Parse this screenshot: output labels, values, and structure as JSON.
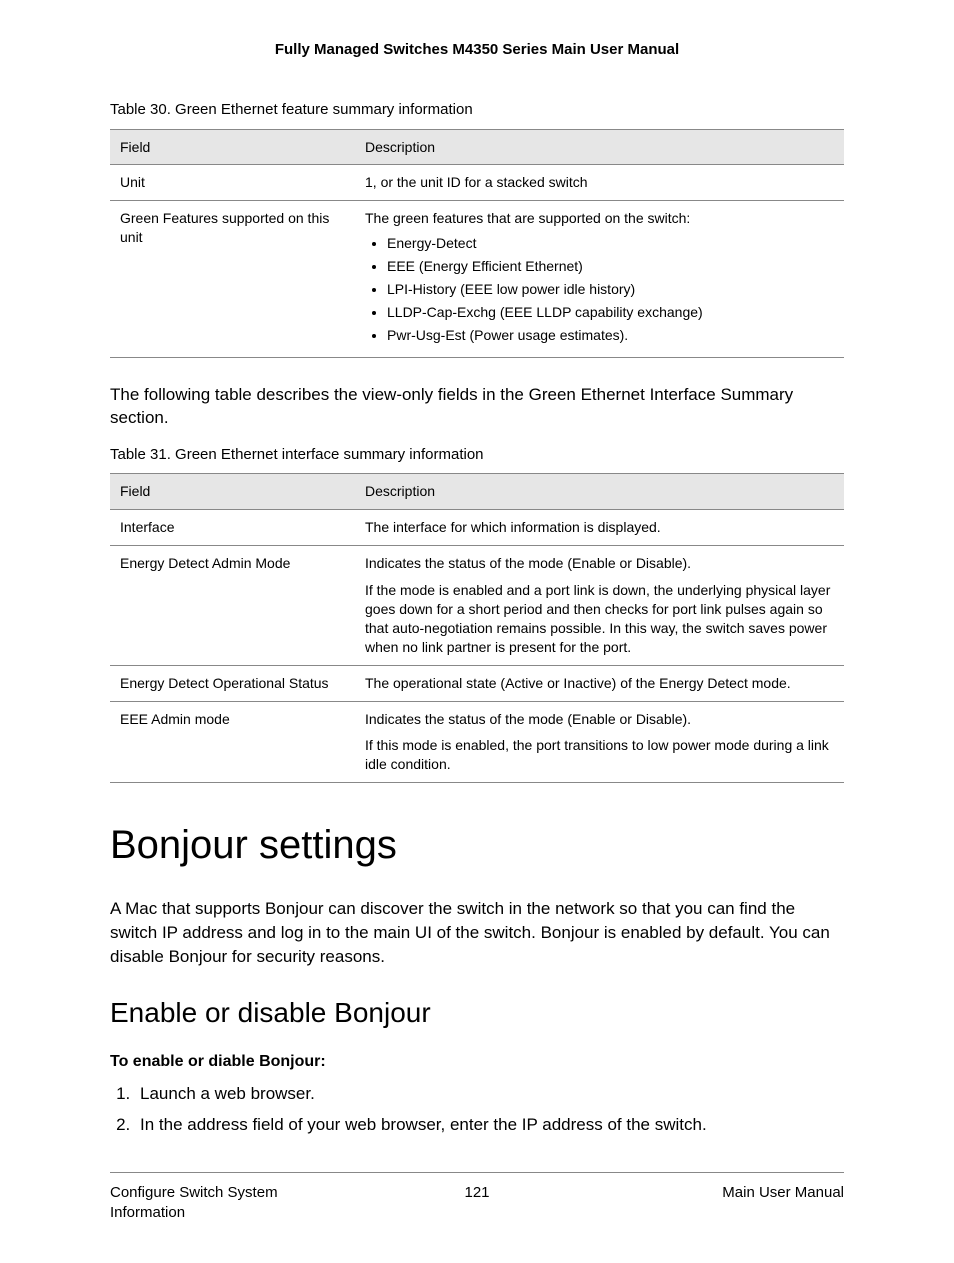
{
  "header": {
    "title": "Fully Managed Switches M4350 Series Main User Manual"
  },
  "table30": {
    "caption": "Table 30. Green Ethernet feature summary information",
    "head": {
      "field": "Field",
      "desc": "Description"
    },
    "rows": [
      {
        "field": "Unit",
        "desc": "1, or the unit ID for a stacked switch"
      },
      {
        "field": "Green Features supported on this unit",
        "desc_intro": "The green features that are supported on the switch:",
        "features": [
          "Energy-Detect",
          "EEE (Energy Efficient Ethernet)",
          "LPI-History (EEE low power idle history)",
          "LLDP-Cap-Exchg (EEE LLDP capability exchange)",
          "Pwr-Usg-Est (Power usage estimates)."
        ]
      }
    ]
  },
  "para1": "The following table describes the view-only fields in the Green Ethernet Interface Summary section.",
  "table31": {
    "caption": "Table 31. Green Ethernet interface summary information",
    "head": {
      "field": "Field",
      "desc": "Description"
    },
    "rows": [
      {
        "field": "Interface",
        "desc": "The interface for which information is displayed."
      },
      {
        "field": "Energy Detect Admin Mode",
        "desc1": "Indicates the status of the mode (Enable or Disable).",
        "desc2": "If the mode is enabled and a port link is down, the underlying physical layer goes down for a short period and then checks for port link pulses again so that auto-negotiation remains possible. In this way, the switch saves power when no link partner is present for the port."
      },
      {
        "field": "Energy Detect Operational Status",
        "desc": "The operational state (Active or Inactive) of the Energy Detect mode."
      },
      {
        "field": "EEE Admin mode",
        "desc1": "Indicates the status of the mode (Enable or Disable).",
        "desc2": "If this mode is enabled, the port transitions to low power mode during a link idle condition."
      }
    ]
  },
  "section": {
    "heading": "Bonjour settings",
    "intro": "A Mac that supports Bonjour can discover the switch in the network so that you can find the switch IP address and log in to the main UI of the switch. Bonjour is enabled by default. You can disable Bonjour for security reasons.",
    "subheading": "Enable or disable Bonjour",
    "instruction_heading": "To enable or diable Bonjour:",
    "steps": [
      "Launch a web browser.",
      "In the address field of your web browser, enter the IP address of the switch."
    ]
  },
  "footer": {
    "left": "Configure Switch System Information",
    "center": "121",
    "right": "Main User Manual"
  }
}
